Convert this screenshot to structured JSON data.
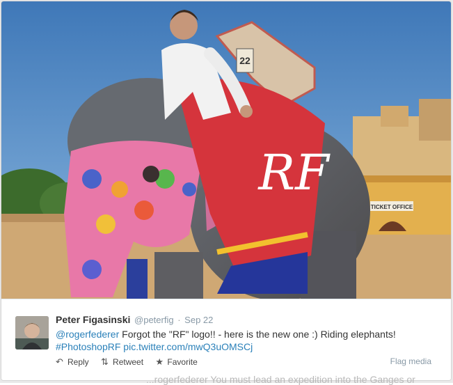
{
  "photo": {
    "description_icon": "photo",
    "sign_number": "22",
    "tent_sign": "TICKET OFFICE",
    "logo_text": "RF"
  },
  "tweet": {
    "fullname": "Peter Figasinski",
    "handle": "@peterfig",
    "separator": "·",
    "timestamp": "Sep 22",
    "mention": "@rogerfederer",
    "text_main": " Forgot the \"RF\" logo!! - here is the new one :) Riding elephants!",
    "hashtag": "#PhotoshopRF",
    "pic_link": "pic.twitter.com/mwQ3uOMSCj"
  },
  "actions": {
    "reply": "Reply",
    "retweet": "Retweet",
    "favorite": "Favorite",
    "flag": "Flag media"
  },
  "background": {
    "peek_text": "...rogerfederer You must lead an expedition into the Ganges or"
  },
  "colors": {
    "link": "#2a80b9",
    "sky": "#5e92c9",
    "saddle_red": "#d5343c"
  }
}
